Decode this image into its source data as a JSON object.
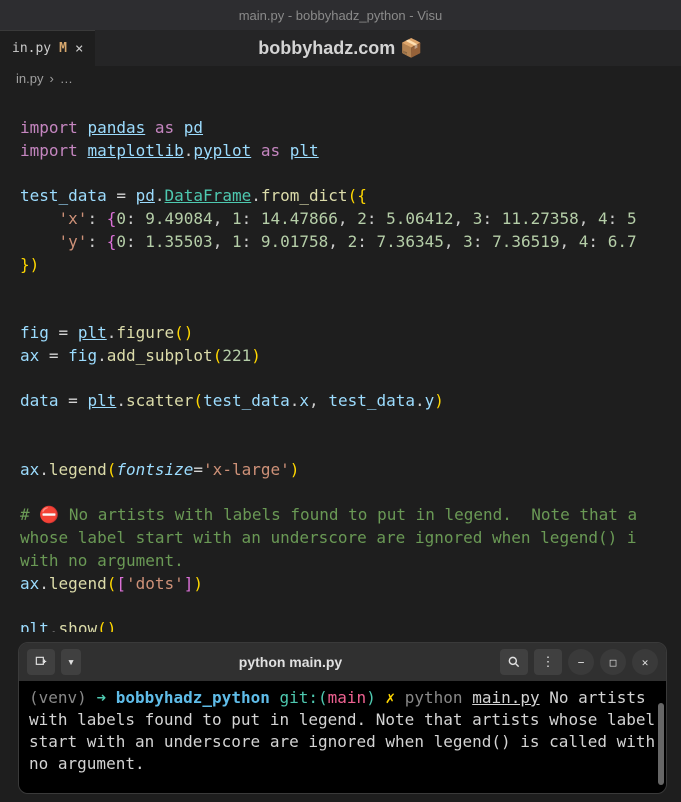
{
  "window": {
    "title": "main.py - bobbyhadz_python - Visu"
  },
  "tab": {
    "label": "in.py",
    "modified_indicator": "M",
    "close": "×"
  },
  "watermark": "bobbyhadz.com 📦",
  "breadcrumb": {
    "file": "in.py",
    "sep": "›",
    "ellipsis": "…"
  },
  "code": {
    "line1": {
      "import": "import",
      "mod": "pandas",
      "as": "as",
      "alias": "pd"
    },
    "line2": {
      "import": "import",
      "mod1": "matplotlib",
      "dot": ".",
      "mod2": "pyplot",
      "as": "as",
      "alias": "plt"
    },
    "line4": {
      "var": "test_data",
      "eq": " = ",
      "mod": "pd",
      "dot": ".",
      "cls": "DataFrame",
      "dot2": ".",
      "func": "from_dict",
      "open": "({"
    },
    "line5": {
      "key": "'x'",
      "colon": ": ",
      "open": "{",
      "k0": "0",
      "c0": ": ",
      "v0": "9.49084",
      "s0": ", ",
      "k1": "1",
      "c1": ": ",
      "v1": "14.47866",
      "s1": ", ",
      "k2": "2",
      "c2": ": ",
      "v2": "5.06412",
      "s2": ", ",
      "k3": "3",
      "c3": ": ",
      "v3": "11.27358",
      "s3": ", ",
      "k4": "4",
      "c4": ": ",
      "v4": "5"
    },
    "line6": {
      "key": "'y'",
      "colon": ": ",
      "open": "{",
      "k0": "0",
      "c0": ": ",
      "v0": "1.35503",
      "s0": ", ",
      "k1": "1",
      "c1": ": ",
      "v1": "9.01758",
      "s1": ", ",
      "k2": "2",
      "c2": ": ",
      "v2": "7.36345",
      "s2": ", ",
      "k3": "3",
      "c3": ": ",
      "v3": "7.36519",
      "s3": ", ",
      "k4": "4",
      "c4": ": ",
      "v4": "6.7"
    },
    "line7": {
      "close": "})"
    },
    "line10": {
      "var": "fig",
      "eq": " = ",
      "mod": "plt",
      "dot": ".",
      "func": "figure",
      "parens": "()"
    },
    "line11": {
      "var": "ax",
      "eq": " = ",
      "obj": "fig",
      "dot": ".",
      "func": "add_subplot",
      "open": "(",
      "arg": "221",
      "close": ")"
    },
    "line13": {
      "var": "data",
      "eq": " = ",
      "mod": "plt",
      "dot": ".",
      "func": "scatter",
      "open": "(",
      "a1": "test_data",
      "d1": ".",
      "a1b": "x",
      "s": ", ",
      "a2": "test_data",
      "d2": ".",
      "a2b": "y",
      "close": ")"
    },
    "line16": {
      "obj": "ax",
      "dot": ".",
      "func": "legend",
      "open": "(",
      "param": "fontsize",
      "eq": "=",
      "val": "'x-large'",
      "close": ")"
    },
    "line18": {
      "comment": "# ⛔️ No artists with labels found to put in legend.  Note that a"
    },
    "line19": {
      "comment": "whose label start with an underscore are ignored when legend() i"
    },
    "line20": {
      "comment": "with no argument."
    },
    "line21": {
      "obj": "ax",
      "dot": ".",
      "func": "legend",
      "open": "(",
      "bopen": "[",
      "val": "'dots'",
      "bclose": "]",
      "close": ")"
    },
    "line23": {
      "mod": "plt",
      "dot": ".",
      "func": "show",
      "parens": "()"
    }
  },
  "terminal": {
    "title": "python main.py",
    "prompt": {
      "venv": "(venv)",
      "arrow": "➜",
      "path": "bobbyhadz_python",
      "git_label": "git:(",
      "branch": "main",
      "git_close": ")",
      "x": "✗",
      "cmd": "python",
      "file": "main.py"
    },
    "output": "No artists with labels found to put in legend.  Note that artists whose label start with an underscore are ignored when legend() is called with no argument."
  }
}
